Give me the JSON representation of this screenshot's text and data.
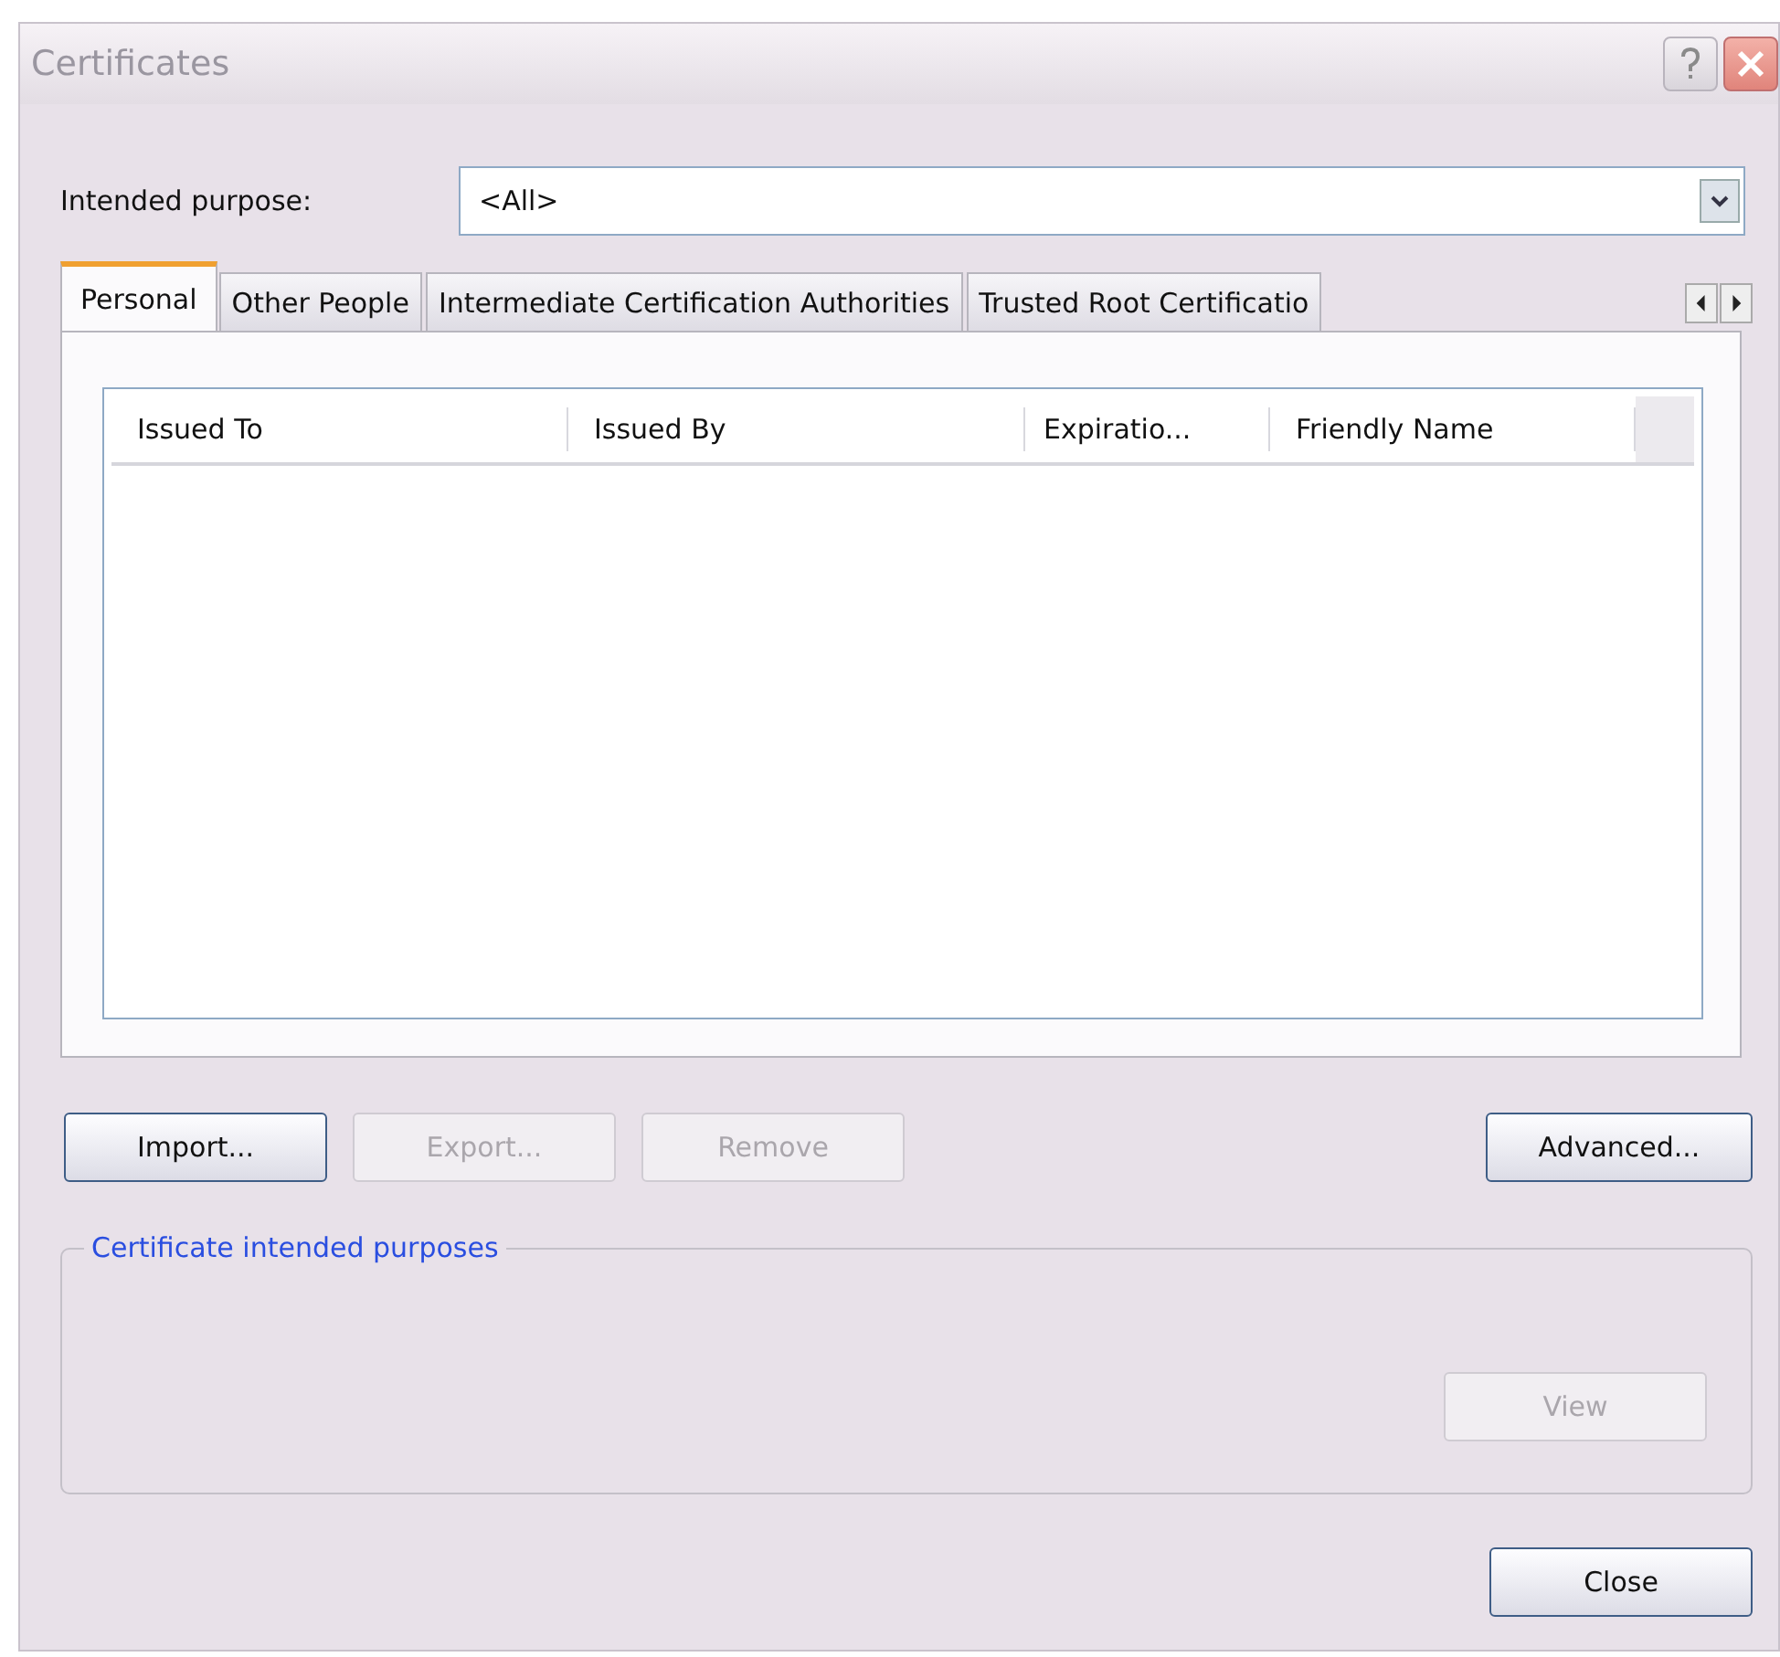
{
  "window": {
    "title": "Certificates"
  },
  "purpose": {
    "label": "Intended purpose:",
    "value": "<All>"
  },
  "tabs": [
    {
      "label": "Personal",
      "selected": true
    },
    {
      "label": "Other People",
      "selected": false
    },
    {
      "label": "Intermediate Certification Authorities",
      "selected": false
    },
    {
      "label": "Trusted Root Certificatio",
      "selected": false
    }
  ],
  "table": {
    "columns": [
      "Issued To",
      "Issued By",
      "Expiratio...",
      "Friendly Name"
    ]
  },
  "buttons": [
    {
      "label": "Import...",
      "disabled": false
    },
    {
      "label": "Export...",
      "disabled": true
    },
    {
      "label": "Remove",
      "disabled": true
    }
  ],
  "advanced_button": {
    "label": "Advanced...",
    "disabled": false
  },
  "group": {
    "title": "Certificate intended purposes",
    "button": {
      "label": "View",
      "disabled": true
    }
  },
  "close_button": {
    "label": "Close",
    "disabled": false
  }
}
